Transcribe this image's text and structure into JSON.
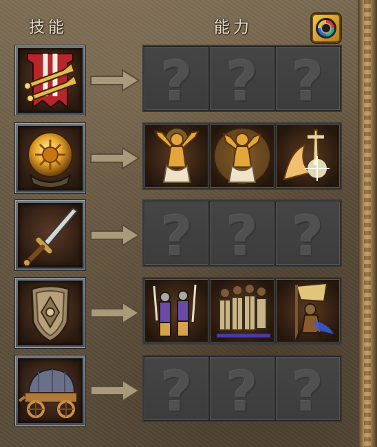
{
  "header": {
    "skill_title": "技能",
    "ability_title": "能力",
    "corner_button_icon": "color-wheel-icon"
  },
  "rows": [
    {
      "skill_icon": "trumpets-banner-icon",
      "abilities": [
        {
          "state": "locked",
          "glyph": "?"
        },
        {
          "state": "locked",
          "glyph": "?"
        },
        {
          "state": "locked",
          "glyph": "?"
        }
      ]
    },
    {
      "skill_icon": "crystal-ball-sun-icon",
      "abilities": [
        {
          "state": "unlocked",
          "icon": "golden-angel-icon"
        },
        {
          "state": "unlocked",
          "icon": "golden-angel-glow-icon"
        },
        {
          "state": "unlocked",
          "icon": "holy-strike-icon"
        }
      ]
    },
    {
      "skill_icon": "sword-icon",
      "abilities": [
        {
          "state": "locked",
          "glyph": "?"
        },
        {
          "state": "locked",
          "glyph": "?"
        },
        {
          "state": "locked",
          "glyph": "?"
        }
      ]
    },
    {
      "skill_icon": "shield-icon",
      "abilities": [
        {
          "state": "unlocked",
          "icon": "swordsmen-squad-icon"
        },
        {
          "state": "unlocked",
          "icon": "shield-wall-icon"
        },
        {
          "state": "unlocked",
          "icon": "charging-knight-icon"
        }
      ]
    },
    {
      "skill_icon": "covered-wagon-icon",
      "abilities": [
        {
          "state": "locked",
          "glyph": "?"
        },
        {
          "state": "locked",
          "glyph": "?"
        },
        {
          "state": "locked",
          "glyph": "?"
        }
      ]
    }
  ],
  "colors": {
    "gold": "#e0a93a",
    "panel_dark": "#3c3c3c",
    "arrow": "#a89a7a"
  }
}
